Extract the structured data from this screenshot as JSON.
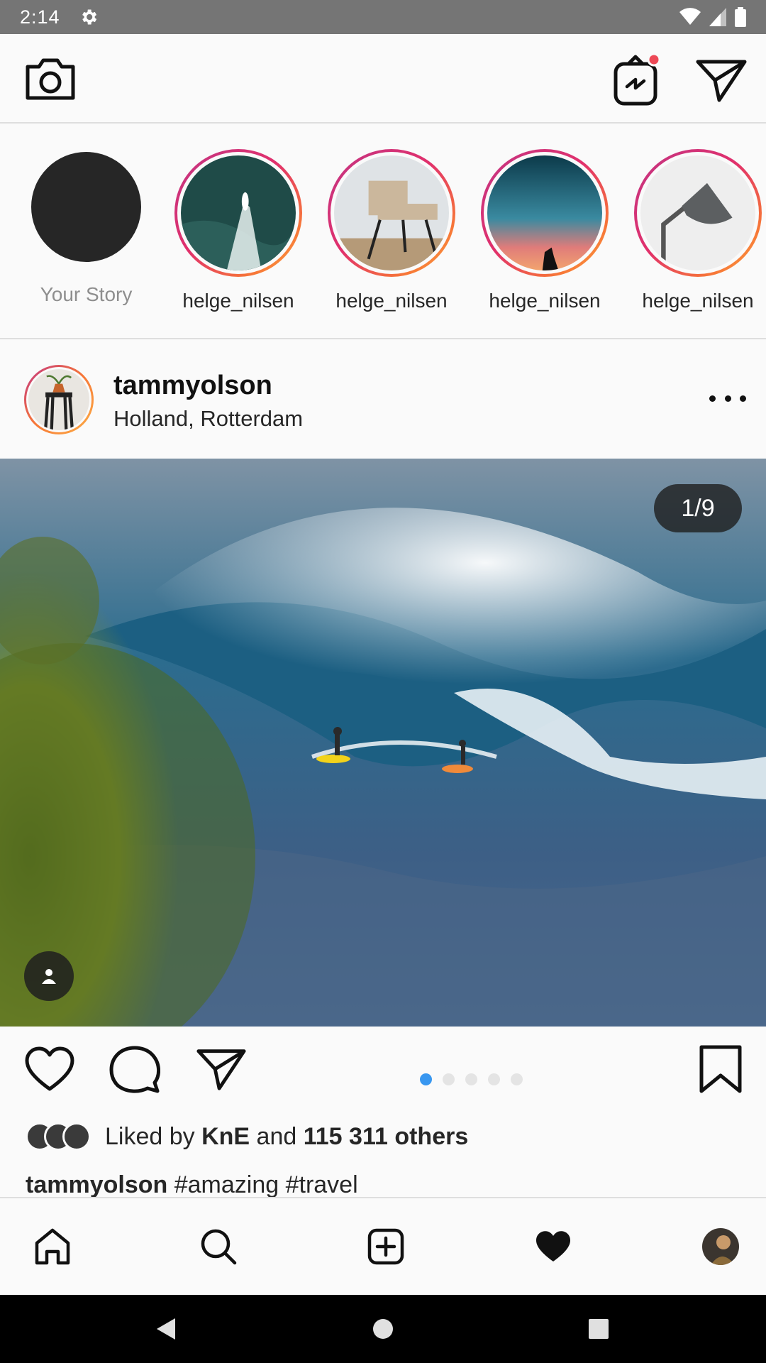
{
  "status_bar": {
    "time": "2:14",
    "icons": [
      "gear-icon",
      "wifi-icon",
      "signal-icon",
      "battery-icon"
    ]
  },
  "top_bar": {
    "icons": [
      "camera-icon",
      "igtv-icon",
      "direct-message-icon"
    ],
    "notification_color": "#ed4956"
  },
  "stories": {
    "your_story_label": "Your Story",
    "items": [
      {
        "label": "helge_nilsen"
      },
      {
        "label": "helge_nilsen"
      },
      {
        "label": "helge_nilsen"
      },
      {
        "label": "helge_nilsen"
      }
    ]
  },
  "post": {
    "username": "tammyolson",
    "location": "Holland, Rotterdam",
    "media_counter": "1/9",
    "carousel_dots": 5,
    "active_dot": 1,
    "liked_by_prefix": "Liked by",
    "liked_by_user": "KnE",
    "liked_by_and": "and",
    "liked_by_others": "115 311 others",
    "caption_username": "tammyolson",
    "caption_text": "#amazing #travel"
  },
  "bottom_nav": {
    "items": [
      "home-icon",
      "search-icon",
      "add-post-icon",
      "activity-heart-icon",
      "profile-avatar"
    ]
  },
  "colors": {
    "accent_blue": "#3897f0",
    "story_gradient": [
      "#c13584",
      "#e1306c",
      "#f77737",
      "#fcaf45"
    ]
  }
}
